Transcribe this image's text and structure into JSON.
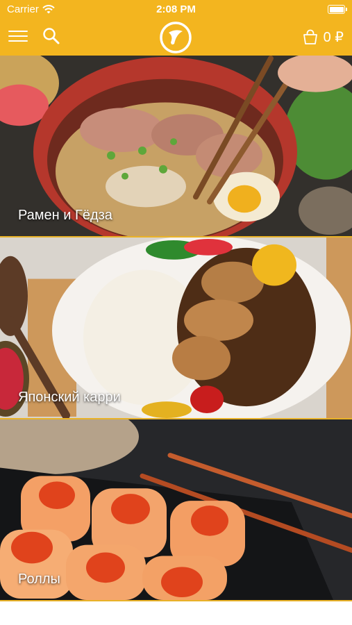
{
  "status_bar": {
    "carrier": "Carrier",
    "time": "2:08 PM"
  },
  "nav": {
    "menu_icon": "hamburger-menu-icon",
    "search_icon": "search-icon",
    "logo_icon": "brand-logo-icon",
    "cart_icon": "shopping-bag-icon",
    "cart_amount": "0 ₽"
  },
  "colors": {
    "accent": "#f3b51f",
    "divider": "#e9b227"
  },
  "categories": [
    {
      "label": "Рамен и Гёдза"
    },
    {
      "label": "Японский карри"
    },
    {
      "label": "Роллы"
    }
  ]
}
